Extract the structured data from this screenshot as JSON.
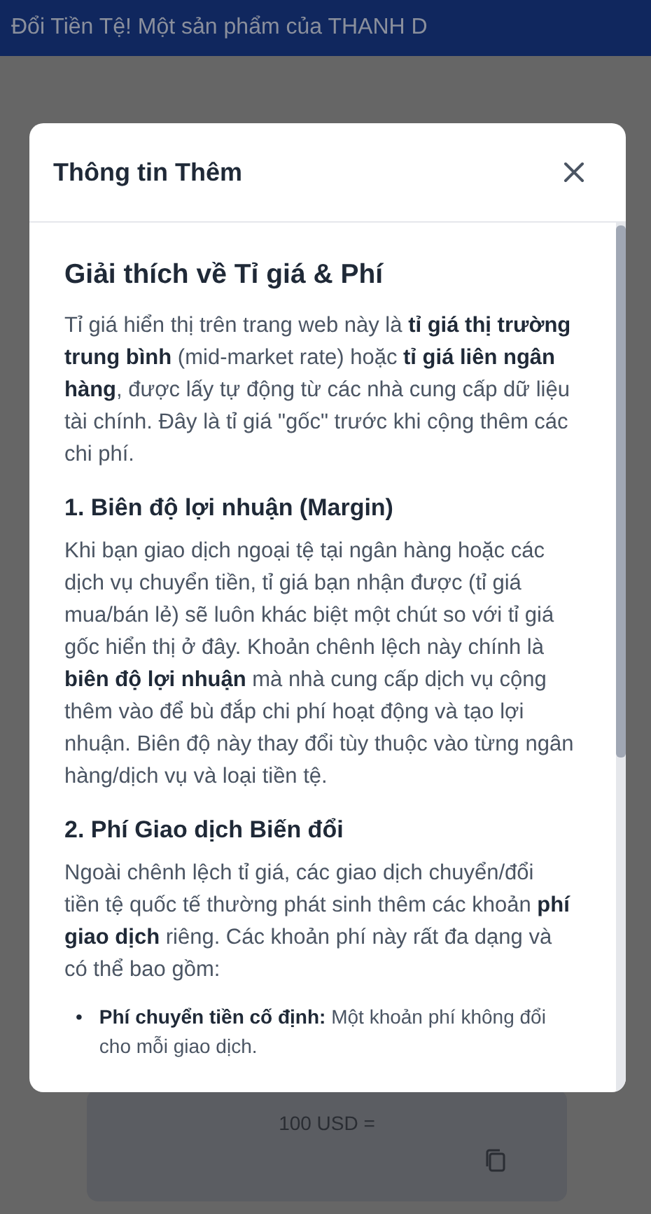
{
  "banner": {
    "text": "Đổi Tiền Tệ! Một sản phẩm của THANH D"
  },
  "modal": {
    "title": "Thông tin Thêm",
    "sections": [
      {
        "kind": "h2",
        "text": "Giải thích về Tỉ giá & Phí"
      },
      {
        "kind": "p",
        "text": "Tỉ giá hiển thị trên trang web này là **tỉ giá thị trường trung bình** (mid-market rate) hoặc **tỉ giá liên ngân hàng**, được lấy tự động từ các nhà cung cấp dữ liệu tài chính. Đây là tỉ giá \"gốc\" trước khi cộng thêm các chi phí."
      },
      {
        "kind": "h3",
        "text": "1. Biên độ lợi nhuận (Margin)"
      },
      {
        "kind": "p",
        "text": "Khi bạn giao dịch ngoại tệ tại ngân hàng hoặc các dịch vụ chuyển tiền, tỉ giá bạn nhận được (tỉ giá mua/bán lẻ) sẽ luôn khác biệt một chút so với tỉ giá gốc hiển thị ở đây. Khoản chênh lệch này chính là **biên độ lợi nhuận** mà nhà cung cấp dịch vụ cộng thêm vào để bù đắp chi phí hoạt động và tạo lợi nhuận. Biên độ này thay đổi tùy thuộc vào từng ngân hàng/dịch vụ và loại tiền tệ."
      },
      {
        "kind": "h3",
        "text": "2. Phí Giao dịch Biến đổi"
      },
      {
        "kind": "p",
        "text": "Ngoài chênh lệch tỉ giá, các giao dịch chuyển/đổi tiền tệ quốc tế thường phát sinh thêm các khoản **phí giao dịch** riêng. Các khoản phí này rất đa dạng và có thể bao gồm:"
      },
      {
        "kind": "bullets",
        "items": [
          {
            "marker": "•",
            "text": "**Phí chuyển tiền cố định:** Một khoản phí không đổi cho mỗi giao dịch."
          }
        ]
      }
    ]
  },
  "result_card": {
    "label": "100 USD ="
  }
}
